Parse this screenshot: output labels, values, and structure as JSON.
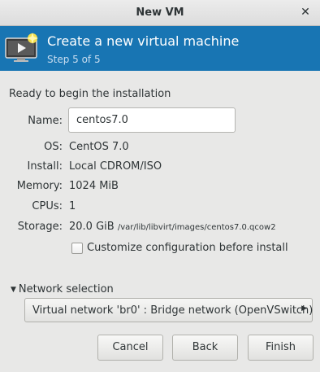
{
  "window": {
    "title": "New VM",
    "close_glyph": "✕"
  },
  "banner": {
    "title": "Create a new virtual machine",
    "step": "Step 5 of 5",
    "icon": "monitor-play-icon"
  },
  "summary": {
    "heading": "Ready to begin the installation",
    "name_label": "Name:",
    "name_value": "centos7.0",
    "os_label": "OS:",
    "os_value": "CentOS 7.0",
    "install_label": "Install:",
    "install_value": "Local CDROM/ISO",
    "memory_label": "Memory:",
    "memory_value": "1024 MiB",
    "cpus_label": "CPUs:",
    "cpus_value": "1",
    "storage_label": "Storage:",
    "storage_size": "20.0 GiB",
    "storage_path": "/var/lib/libvirt/images/centos7.0.qcow2"
  },
  "customize": {
    "label": "Customize configuration before install",
    "checked": false
  },
  "network": {
    "toggle_label": "Network selection",
    "expanded": true,
    "selected": "Virtual network 'br0' : Bridge network (OpenVSwitch)"
  },
  "buttons": {
    "cancel": "Cancel",
    "back": "Back",
    "finish": "Finish"
  },
  "colors": {
    "banner": "#1875b3",
    "background": "#e8e8e7"
  }
}
